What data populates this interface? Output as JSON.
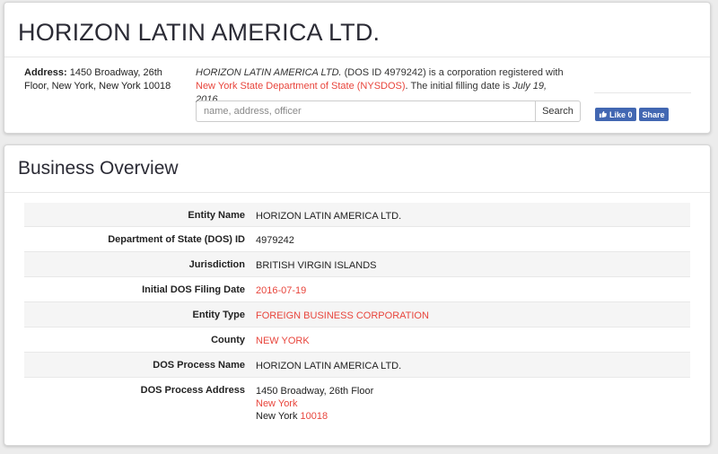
{
  "company": {
    "title": "HORIZON LATIN AMERICA LTD.",
    "address_label": "Address:",
    "address_value": "1450 Broadway, 26th Floor, New York, New York 10018",
    "desc_name": "HORIZON LATIN AMERICA LTD.",
    "desc_text1": " (DOS ID 4979242) is a corporation registered with ",
    "desc_link": "New York State Department of State (NYSDOS)",
    "desc_text2": ". The initial filling date is ",
    "desc_date": "July 19, 2016",
    "desc_end": "."
  },
  "search": {
    "placeholder": "name, address, officer",
    "button_label": "Search"
  },
  "social": {
    "like_label": "Like 0",
    "share_label": "Share"
  },
  "overview": {
    "title": "Business Overview",
    "rows": [
      {
        "label": "Entity Name",
        "value": "HORIZON LATIN AMERICA LTD."
      },
      {
        "label": "Department of State (DOS) ID",
        "value": "4979242"
      },
      {
        "label": "Jurisdiction",
        "value": "BRITISH VIRGIN ISLANDS"
      },
      {
        "label": "Initial DOS Filing Date",
        "value": "2016-07-19"
      },
      {
        "label": "Entity Type",
        "value": "FOREIGN BUSINESS CORPORATION"
      },
      {
        "label": "County",
        "value": "NEW YORK"
      },
      {
        "label": "DOS Process Name",
        "value": "HORIZON LATIN AMERICA LTD."
      },
      {
        "label": "DOS Process Address",
        "street": "1450 Broadway, 26th Floor",
        "city_link": "New York",
        "city": "New York",
        "zip": "10018"
      }
    ]
  },
  "colors": {
    "link": "#e8453c",
    "facebook": "#4267b2"
  }
}
